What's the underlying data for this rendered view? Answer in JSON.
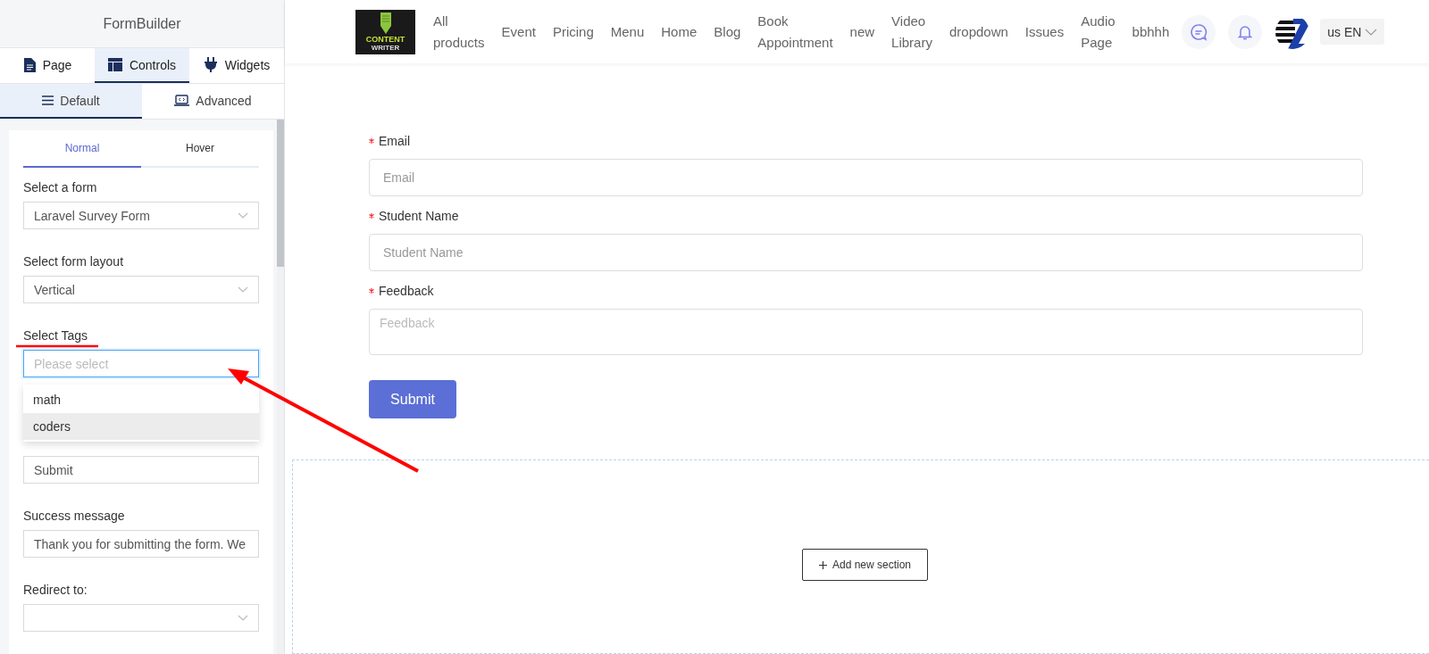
{
  "sidebar": {
    "title": "FormBuilder",
    "tabs": [
      {
        "label": "Page",
        "selected": false
      },
      {
        "label": "Controls",
        "selected": true
      },
      {
        "label": "Widgets",
        "selected": false
      }
    ],
    "subtabs": [
      {
        "label": "Default",
        "selected": true
      },
      {
        "label": "Advanced",
        "selected": false
      }
    ],
    "style_tabs": [
      {
        "label": "Normal",
        "selected": true
      },
      {
        "label": "Hover",
        "selected": false
      }
    ],
    "fields": [
      {
        "kind": "select",
        "label": "Select a form",
        "value": "Laravel Survey Form"
      },
      {
        "kind": "select",
        "label": "Select form layout",
        "value": "Vertical"
      },
      {
        "kind": "tags",
        "label": "Select Tags",
        "placeholder": "Please select",
        "focused": true,
        "options": [
          {
            "label": "math",
            "highlighted": false
          },
          {
            "label": "coders",
            "highlighted": true
          }
        ]
      },
      {
        "kind": "input",
        "value": "Submit"
      },
      {
        "kind": "input",
        "label": "Success message",
        "value": "Thank you for submitting the form. We"
      },
      {
        "kind": "select",
        "label": "Redirect to:"
      }
    ]
  },
  "nav": {
    "logo": {
      "title": "CONTENT",
      "subtitle": "WRITER"
    },
    "links": [
      "All products",
      "Event",
      "Pricing",
      "Menu",
      "Home",
      "Blog",
      "Book Appointment",
      "new",
      "Video Library",
      "dropdown",
      "Issues",
      "Audio Page",
      "bbhhh"
    ],
    "language": "us EN"
  },
  "form": {
    "fields": [
      {
        "label": "Email",
        "required": true,
        "kind": "input",
        "placeholder": "Email"
      },
      {
        "label": "Student Name",
        "required": true,
        "kind": "input",
        "placeholder": "Student Name"
      },
      {
        "label": "Feedback",
        "required": true,
        "kind": "textarea",
        "placeholder": "Feedback"
      }
    ],
    "submit": "Submit"
  },
  "section": {
    "add_button": "Add new section"
  }
}
